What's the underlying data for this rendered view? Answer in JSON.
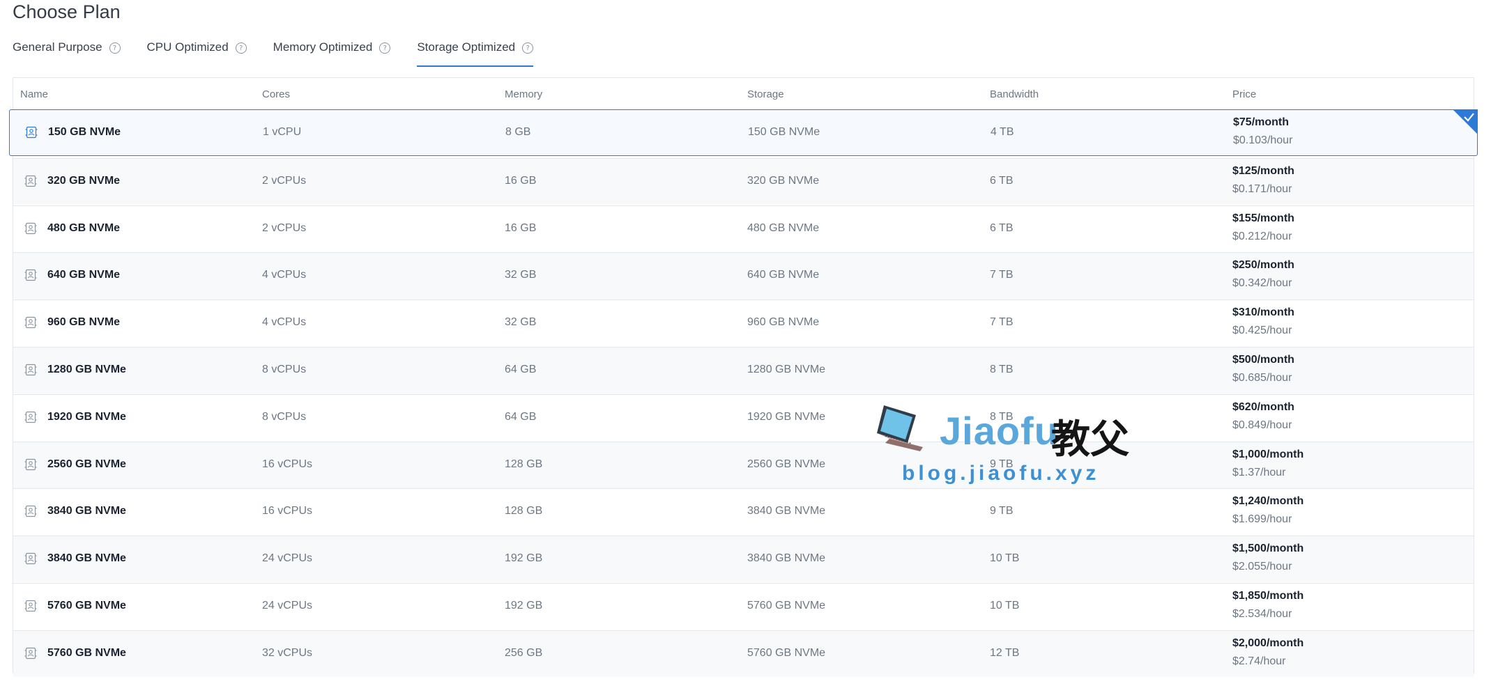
{
  "page_title": "Choose Plan",
  "tabs": [
    {
      "label": "General Purpose",
      "active": false
    },
    {
      "label": "CPU Optimized",
      "active": false
    },
    {
      "label": "Memory Optimized",
      "active": false
    },
    {
      "label": "Storage Optimized",
      "active": true
    }
  ],
  "help_icon_glyph": "?",
  "columns": {
    "name": "Name",
    "cores": "Cores",
    "memory": "Memory",
    "storage": "Storage",
    "bandwidth": "Bandwidth",
    "price": "Price"
  },
  "plans": [
    {
      "name": "150 GB NVMe",
      "cores": "1 vCPU",
      "memory": "8 GB",
      "storage": "150 GB NVMe",
      "bandwidth": "4 TB",
      "monthly": "$75/month",
      "hourly": "$0.103/hour",
      "selected": true
    },
    {
      "name": "320 GB NVMe",
      "cores": "2 vCPUs",
      "memory": "16 GB",
      "storage": "320 GB NVMe",
      "bandwidth": "6 TB",
      "monthly": "$125/month",
      "hourly": "$0.171/hour"
    },
    {
      "name": "480 GB NVMe",
      "cores": "2 vCPUs",
      "memory": "16 GB",
      "storage": "480 GB NVMe",
      "bandwidth": "6 TB",
      "monthly": "$155/month",
      "hourly": "$0.212/hour"
    },
    {
      "name": "640 GB NVMe",
      "cores": "4 vCPUs",
      "memory": "32 GB",
      "storage": "640 GB NVMe",
      "bandwidth": "7 TB",
      "monthly": "$250/month",
      "hourly": "$0.342/hour"
    },
    {
      "name": "960 GB NVMe",
      "cores": "4 vCPUs",
      "memory": "32 GB",
      "storage": "960 GB NVMe",
      "bandwidth": "7 TB",
      "monthly": "$310/month",
      "hourly": "$0.425/hour"
    },
    {
      "name": "1280 GB NVMe",
      "cores": "8 vCPUs",
      "memory": "64 GB",
      "storage": "1280 GB NVMe",
      "bandwidth": "8 TB",
      "monthly": "$500/month",
      "hourly": "$0.685/hour"
    },
    {
      "name": "1920 GB NVMe",
      "cores": "8 vCPUs",
      "memory": "64 GB",
      "storage": "1920 GB NVMe",
      "bandwidth": "8 TB",
      "monthly": "$620/month",
      "hourly": "$0.849/hour"
    },
    {
      "name": "2560 GB NVMe",
      "cores": "16 vCPUs",
      "memory": "128 GB",
      "storage": "2560 GB NVMe",
      "bandwidth": "9 TB",
      "monthly": "$1,000/month",
      "hourly": "$1.37/hour"
    },
    {
      "name": "3840 GB NVMe",
      "cores": "16 vCPUs",
      "memory": "128 GB",
      "storage": "3840 GB NVMe",
      "bandwidth": "9 TB",
      "monthly": "$1,240/month",
      "hourly": "$1.699/hour"
    },
    {
      "name": "3840 GB NVMe",
      "cores": "24 vCPUs",
      "memory": "192 GB",
      "storage": "3840 GB NVMe",
      "bandwidth": "10 TB",
      "monthly": "$1,500/month",
      "hourly": "$2.055/hour"
    },
    {
      "name": "5760 GB NVMe",
      "cores": "24 vCPUs",
      "memory": "192 GB",
      "storage": "5760 GB NVMe",
      "bandwidth": "10 TB",
      "monthly": "$1,850/month",
      "hourly": "$2.534/hour"
    },
    {
      "name": "5760 GB NVMe",
      "cores": "32 vCPUs",
      "memory": "256 GB",
      "storage": "5760 GB NVMe",
      "bandwidth": "12 TB",
      "monthly": "$2,000/month",
      "hourly": "$2.74/hour"
    }
  ],
  "icons": {
    "plan": "server-icon",
    "help": "help-circle-icon",
    "selected": "checkmark-icon"
  },
  "watermark": {
    "brand": "Jiaofu",
    "brand_cn": "教父",
    "url": "blog.jiaofu.xyz"
  },
  "colors": {
    "accent": "#2d7ad6",
    "row_alt": "#f7f9fb",
    "border": "#e3e7ec",
    "muted_text": "#6d7783"
  }
}
